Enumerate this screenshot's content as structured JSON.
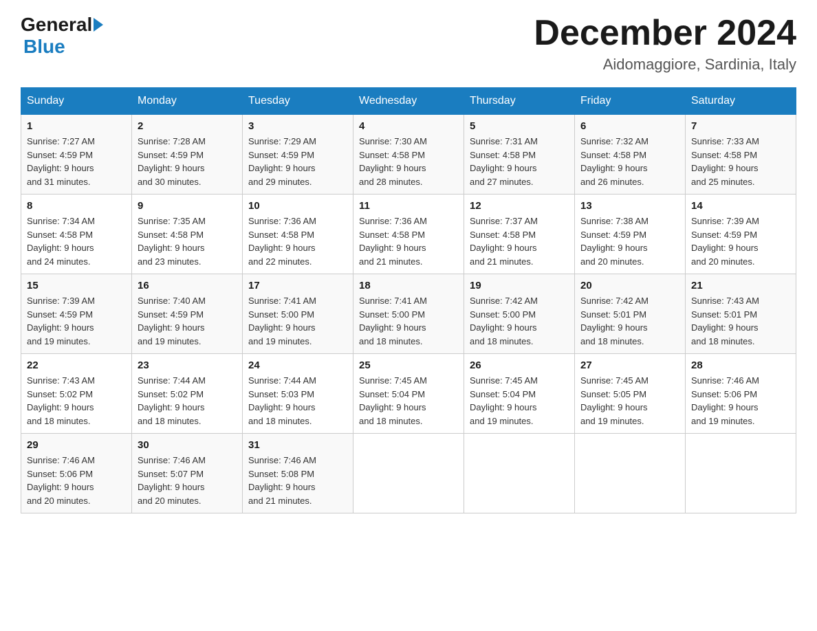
{
  "header": {
    "logo_general": "General",
    "logo_blue": "Blue",
    "month_title": "December 2024",
    "location": "Aidomaggiore, Sardinia, Italy"
  },
  "days_of_week": [
    "Sunday",
    "Monday",
    "Tuesday",
    "Wednesday",
    "Thursday",
    "Friday",
    "Saturday"
  ],
  "weeks": [
    [
      {
        "day": "1",
        "sunrise": "7:27 AM",
        "sunset": "4:59 PM",
        "daylight": "9 hours and 31 minutes."
      },
      {
        "day": "2",
        "sunrise": "7:28 AM",
        "sunset": "4:59 PM",
        "daylight": "9 hours and 30 minutes."
      },
      {
        "day": "3",
        "sunrise": "7:29 AM",
        "sunset": "4:59 PM",
        "daylight": "9 hours and 29 minutes."
      },
      {
        "day": "4",
        "sunrise": "7:30 AM",
        "sunset": "4:58 PM",
        "daylight": "9 hours and 28 minutes."
      },
      {
        "day": "5",
        "sunrise": "7:31 AM",
        "sunset": "4:58 PM",
        "daylight": "9 hours and 27 minutes."
      },
      {
        "day": "6",
        "sunrise": "7:32 AM",
        "sunset": "4:58 PM",
        "daylight": "9 hours and 26 minutes."
      },
      {
        "day": "7",
        "sunrise": "7:33 AM",
        "sunset": "4:58 PM",
        "daylight": "9 hours and 25 minutes."
      }
    ],
    [
      {
        "day": "8",
        "sunrise": "7:34 AM",
        "sunset": "4:58 PM",
        "daylight": "9 hours and 24 minutes."
      },
      {
        "day": "9",
        "sunrise": "7:35 AM",
        "sunset": "4:58 PM",
        "daylight": "9 hours and 23 minutes."
      },
      {
        "day": "10",
        "sunrise": "7:36 AM",
        "sunset": "4:58 PM",
        "daylight": "9 hours and 22 minutes."
      },
      {
        "day": "11",
        "sunrise": "7:36 AM",
        "sunset": "4:58 PM",
        "daylight": "9 hours and 21 minutes."
      },
      {
        "day": "12",
        "sunrise": "7:37 AM",
        "sunset": "4:58 PM",
        "daylight": "9 hours and 21 minutes."
      },
      {
        "day": "13",
        "sunrise": "7:38 AM",
        "sunset": "4:59 PM",
        "daylight": "9 hours and 20 minutes."
      },
      {
        "day": "14",
        "sunrise": "7:39 AM",
        "sunset": "4:59 PM",
        "daylight": "9 hours and 20 minutes."
      }
    ],
    [
      {
        "day": "15",
        "sunrise": "7:39 AM",
        "sunset": "4:59 PM",
        "daylight": "9 hours and 19 minutes."
      },
      {
        "day": "16",
        "sunrise": "7:40 AM",
        "sunset": "4:59 PM",
        "daylight": "9 hours and 19 minutes."
      },
      {
        "day": "17",
        "sunrise": "7:41 AM",
        "sunset": "5:00 PM",
        "daylight": "9 hours and 19 minutes."
      },
      {
        "day": "18",
        "sunrise": "7:41 AM",
        "sunset": "5:00 PM",
        "daylight": "9 hours and 18 minutes."
      },
      {
        "day": "19",
        "sunrise": "7:42 AM",
        "sunset": "5:00 PM",
        "daylight": "9 hours and 18 minutes."
      },
      {
        "day": "20",
        "sunrise": "7:42 AM",
        "sunset": "5:01 PM",
        "daylight": "9 hours and 18 minutes."
      },
      {
        "day": "21",
        "sunrise": "7:43 AM",
        "sunset": "5:01 PM",
        "daylight": "9 hours and 18 minutes."
      }
    ],
    [
      {
        "day": "22",
        "sunrise": "7:43 AM",
        "sunset": "5:02 PM",
        "daylight": "9 hours and 18 minutes."
      },
      {
        "day": "23",
        "sunrise": "7:44 AM",
        "sunset": "5:02 PM",
        "daylight": "9 hours and 18 minutes."
      },
      {
        "day": "24",
        "sunrise": "7:44 AM",
        "sunset": "5:03 PM",
        "daylight": "9 hours and 18 minutes."
      },
      {
        "day": "25",
        "sunrise": "7:45 AM",
        "sunset": "5:04 PM",
        "daylight": "9 hours and 18 minutes."
      },
      {
        "day": "26",
        "sunrise": "7:45 AM",
        "sunset": "5:04 PM",
        "daylight": "9 hours and 19 minutes."
      },
      {
        "day": "27",
        "sunrise": "7:45 AM",
        "sunset": "5:05 PM",
        "daylight": "9 hours and 19 minutes."
      },
      {
        "day": "28",
        "sunrise": "7:46 AM",
        "sunset": "5:06 PM",
        "daylight": "9 hours and 19 minutes."
      }
    ],
    [
      {
        "day": "29",
        "sunrise": "7:46 AM",
        "sunset": "5:06 PM",
        "daylight": "9 hours and 20 minutes."
      },
      {
        "day": "30",
        "sunrise": "7:46 AM",
        "sunset": "5:07 PM",
        "daylight": "9 hours and 20 minutes."
      },
      {
        "day": "31",
        "sunrise": "7:46 AM",
        "sunset": "5:08 PM",
        "daylight": "9 hours and 21 minutes."
      },
      null,
      null,
      null,
      null
    ]
  ],
  "labels": {
    "sunrise": "Sunrise:",
    "sunset": "Sunset:",
    "daylight": "Daylight:"
  }
}
